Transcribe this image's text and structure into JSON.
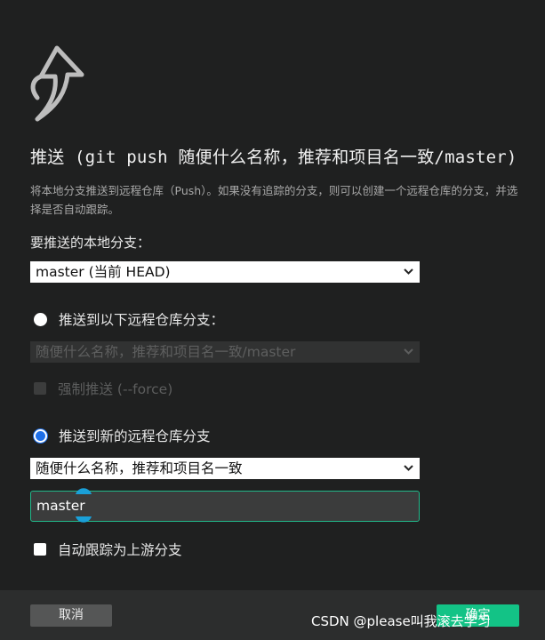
{
  "dialog": {
    "logo_icon": "push-arrow-icon",
    "title": "推送 (git push 随便什么名称，推荐和项目名一致/master)",
    "description": "将本地分支推送到远程仓库（Push）。如果没有追踪的分支，则可以创建一个远程仓库的分支，并选择是否自动跟踪。"
  },
  "local_branch": {
    "label": "要推送的本地分支：",
    "selected": "master (当前 HEAD)"
  },
  "remote_existing": {
    "radio_label": "推送到以下远程仓库分支：",
    "checked": false,
    "selected": "随便什么名称，推荐和项目名一致/master",
    "force_label": "强制推送 (--force)"
  },
  "remote_new": {
    "radio_label": "推送到新的远程仓库分支",
    "checked": true,
    "remote_selected": "随便什么名称，推荐和项目名一致",
    "branch_name": "master"
  },
  "auto_track": {
    "label": "自动跟踪为上游分支",
    "checked": false
  },
  "footer": {
    "cancel_label": "取消",
    "ok_label": "确定"
  },
  "watermark": "CSDN @please叫我滚去学习",
  "colors": {
    "background": "#1f2020",
    "accent": "#13c386",
    "focus_border": "#22b88a",
    "radio_checked": "#1e6fe8"
  }
}
